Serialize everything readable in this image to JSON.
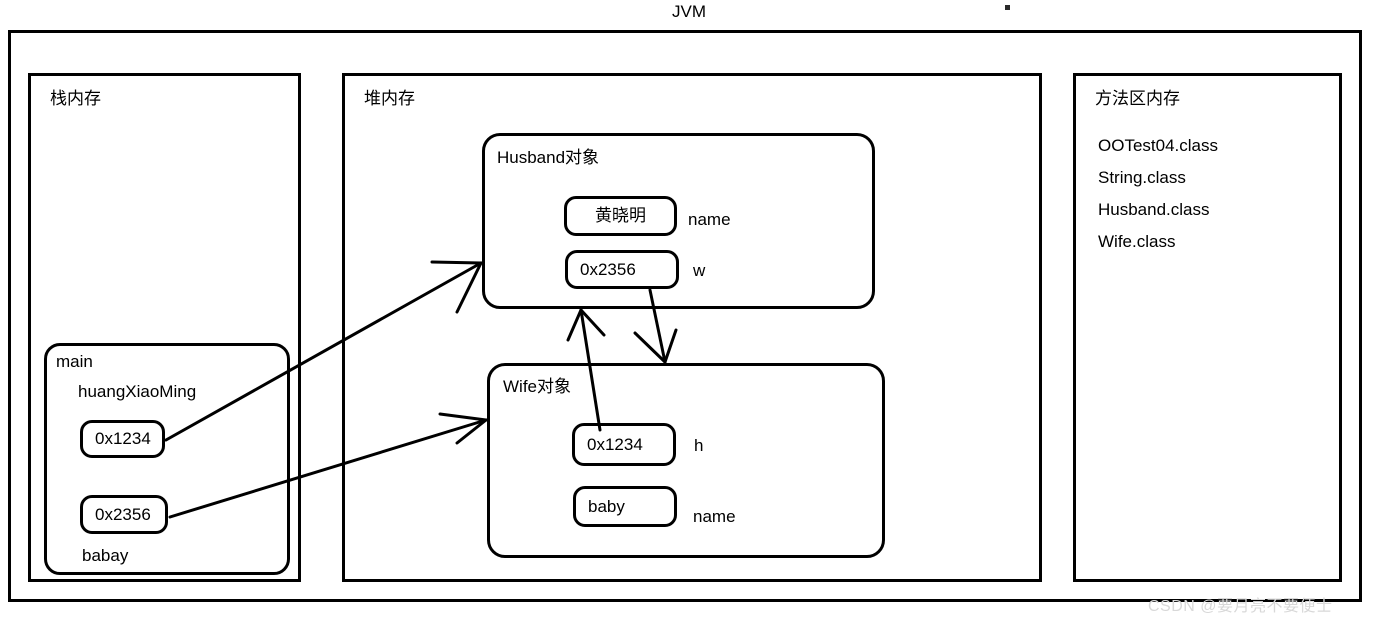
{
  "diagram": {
    "title": "JVM",
    "watermark": "CSDN @要月亮不要便士"
  },
  "regions": {
    "stack": {
      "label": "栈内存"
    },
    "heap": {
      "label": "堆内存"
    },
    "method_area": {
      "label": "方法区内存"
    }
  },
  "stack": {
    "frame": {
      "name": "main",
      "variables": [
        {
          "name": "huangXiaoMing",
          "value": "0x1234"
        },
        {
          "name": "babay",
          "value": "0x2356"
        }
      ],
      "var1_name": "huangXiaoMing",
      "var1_value": "0x1234",
      "var2_name": "babay",
      "var2_value": "0x2356"
    }
  },
  "heap": {
    "objects": [
      {
        "title": "Husband对象",
        "fields": [
          {
            "value": "黄晓明",
            "label": "name"
          },
          {
            "value": "0x2356",
            "label": "w"
          }
        ]
      },
      {
        "title": "Wife对象",
        "fields": [
          {
            "value": "0x1234",
            "label": "h"
          },
          {
            "value": "baby",
            "label": "name"
          }
        ]
      }
    ],
    "husband": {
      "title": "Husband对象",
      "name_value": "黄晓明",
      "name_label": "name",
      "w_value": "0x2356",
      "w_label": "w"
    },
    "wife": {
      "title": "Wife对象",
      "h_value": "0x1234",
      "h_label": "h",
      "name_value": "baby",
      "name_label": "name"
    }
  },
  "method_area": {
    "classes": [
      "OOTest04.class",
      "String.class",
      "Husband.class",
      "Wife.class"
    ]
  },
  "colors": {
    "stroke": "#000000",
    "background": "#ffffff",
    "watermark": "#d8d8d8"
  }
}
